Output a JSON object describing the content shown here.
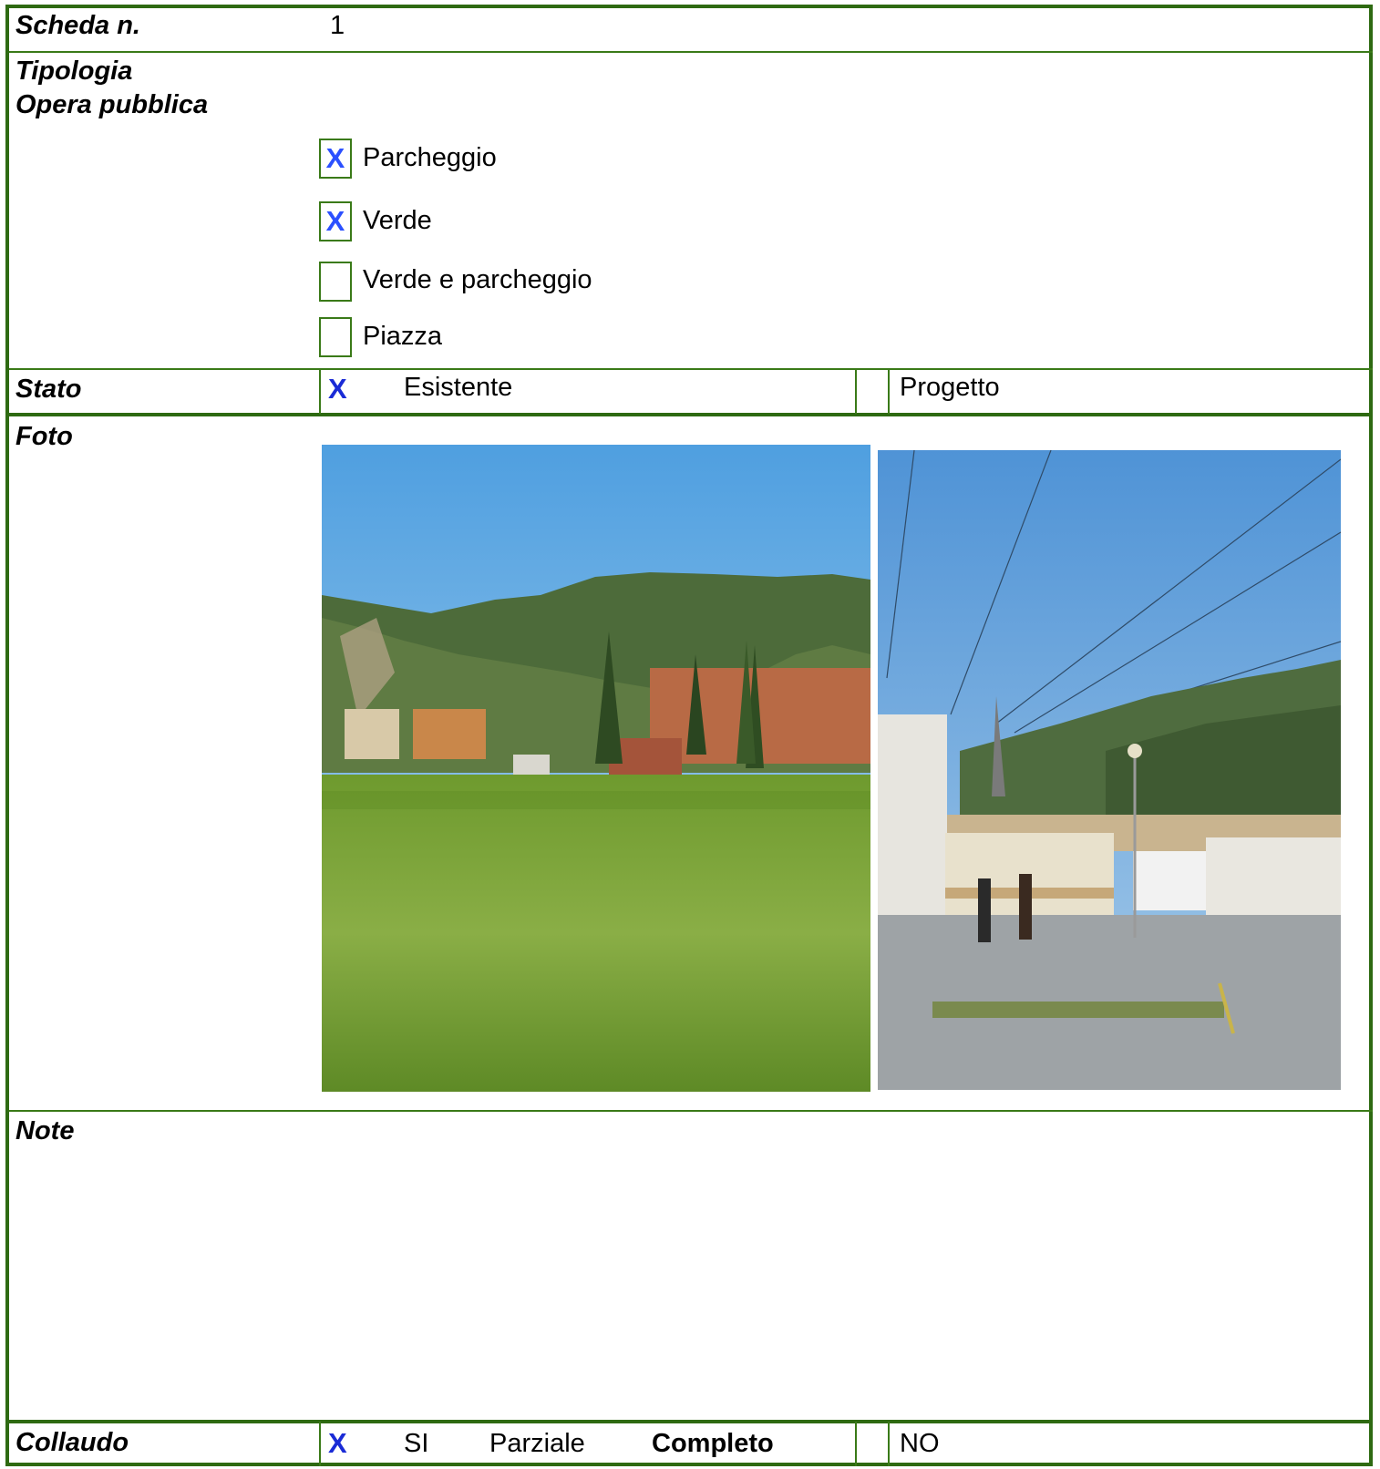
{
  "scheda": {
    "label": "Scheda n.",
    "value": "1"
  },
  "tipologia": {
    "label_line1": "Tipologia",
    "label_line2": "Opera pubblica",
    "options": [
      {
        "label": "Parcheggio",
        "mark": "X"
      },
      {
        "label": "Verde",
        "mark": "X"
      },
      {
        "label": "Verde e parcheggio",
        "mark": ""
      },
      {
        "label": "Piazza",
        "mark": ""
      }
    ]
  },
  "stato": {
    "label": "Stato",
    "mark": "X",
    "existing": "Esistente",
    "project": "Progetto"
  },
  "foto": {
    "label": "Foto"
  },
  "note": {
    "label": "Note"
  },
  "collaudo": {
    "label": "Collaudo",
    "mark": "X",
    "si": "SI",
    "parziale": "Parziale",
    "completo": "Completo",
    "no": "NO"
  },
  "colors": {
    "border": "#2e6a12",
    "check": "#2b50ff"
  }
}
